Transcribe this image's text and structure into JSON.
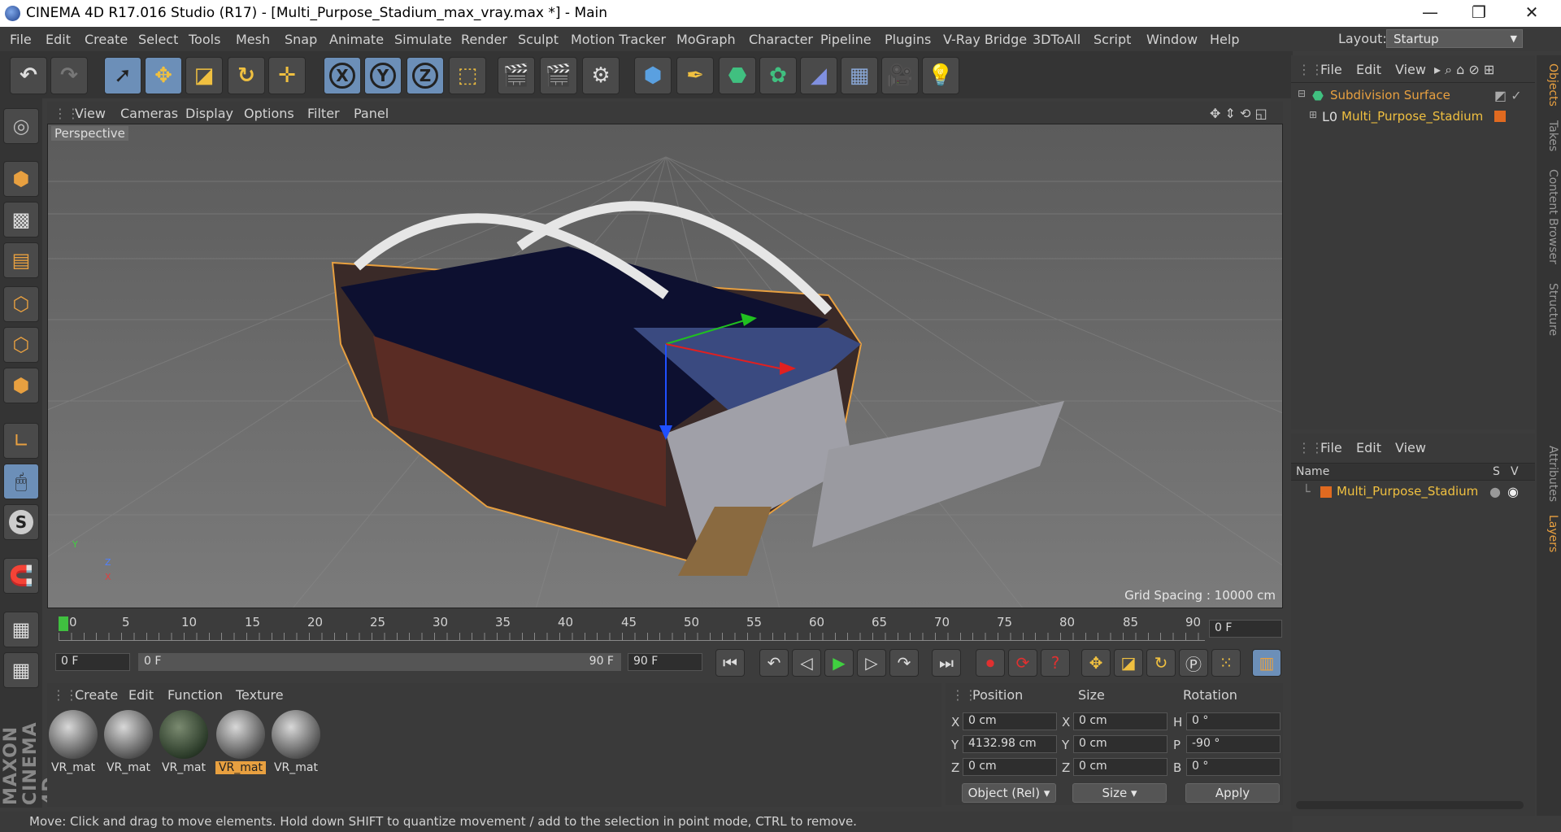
{
  "window": {
    "title": "CINEMA 4D R17.016 Studio (R17) - [Multi_Purpose_Stadium_max_vray.max *] - Main",
    "minimize": "—",
    "maximize": "❐",
    "close": "✕"
  },
  "menu": [
    "File",
    "Edit",
    "Create",
    "Select",
    "Tools",
    "Mesh",
    "Snap",
    "Animate",
    "Simulate",
    "Render",
    "Sculpt",
    "Motion Tracker",
    "MoGraph",
    "Character",
    "Pipeline",
    "Plugins",
    "V-Ray Bridge",
    "3DToAll",
    "Script",
    "Window",
    "Help"
  ],
  "layout": {
    "label": "Layout:",
    "value": "Startup"
  },
  "toolbar": {
    "undo": "↶",
    "redo": "↷",
    "x": "X",
    "y": "Y",
    "z": "Z"
  },
  "viewport": {
    "menu": [
      "View",
      "Cameras",
      "Display",
      "Options",
      "Filter",
      "Panel"
    ],
    "label": "Perspective",
    "grid_spacing": "Grid Spacing : 10000 cm",
    "axis_y": "Y",
    "axis_z": "Z",
    "axis_x": "X"
  },
  "timeline": {
    "ticks": [
      "0",
      "5",
      "10",
      "15",
      "20",
      "25",
      "30",
      "35",
      "40",
      "45",
      "50",
      "55",
      "60",
      "65",
      "70",
      "75",
      "80",
      "85",
      "90"
    ],
    "current_frame": "0 F"
  },
  "transport": {
    "start": "0 F",
    "range_start": "0 F",
    "range_end": "90 F",
    "end": "90 F"
  },
  "materials": {
    "menu": [
      "Create",
      "Edit",
      "Function",
      "Texture"
    ],
    "items": [
      "VR_mat",
      "VR_mat",
      "VR_mat",
      "VR_mat",
      "VR_mat"
    ],
    "selected_index": 3
  },
  "coords": {
    "headers": [
      "Position",
      "Size",
      "Rotation"
    ],
    "rows": [
      {
        "pl": "X",
        "pv": "0 cm",
        "sl": "X",
        "sv": "0 cm",
        "rl": "H",
        "rv": "0 °"
      },
      {
        "pl": "Y",
        "pv": "4132.98 cm",
        "sl": "Y",
        "sv": "0 cm",
        "rl": "P",
        "rv": "-90 °"
      },
      {
        "pl": "Z",
        "pv": "0 cm",
        "sl": "Z",
        "sv": "0 cm",
        "rl": "B",
        "rv": "0 °"
      }
    ],
    "mode": "Object (Rel)",
    "size_mode": "Size",
    "apply": "Apply"
  },
  "objects": {
    "menu": [
      "File",
      "Edit",
      "View"
    ],
    "items": [
      {
        "name": "Subdivision Surface",
        "color": "#e8a040"
      },
      {
        "name": "Multi_Purpose_Stadium",
        "color": "#f0c040"
      }
    ]
  },
  "layers": {
    "menu": [
      "File",
      "Edit",
      "View"
    ],
    "columns": {
      "name": "Name",
      "s": "S",
      "v": "V"
    },
    "items": [
      "Multi_Purpose_Stadium"
    ]
  },
  "side_tabs": [
    "Objects",
    "Takes",
    "Content Browser",
    "Structure",
    "Attributes",
    "Layers"
  ],
  "status": "Move: Click and drag to move elements. Hold down SHIFT to quantize movement / add to the selection in point mode, CTRL to remove.",
  "maxon": "MAXON CINEMA 4D",
  "colors": {
    "accent": "#e8a040",
    "selected_tool": "#6c8fb8"
  }
}
